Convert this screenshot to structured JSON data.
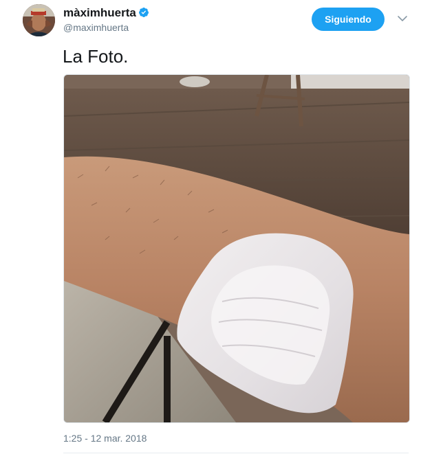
{
  "tweet": {
    "author": {
      "display_name": "màximhuerta",
      "handle": "@maximhuerta",
      "verified": true,
      "verified_icon": "verified-badge-icon",
      "avatar_icon": "avatar"
    },
    "follow_button_label": "Siguiendo",
    "menu_icon": "chevron-down-icon",
    "text": "La Foto.",
    "timestamp": "1:25 - 12 mar. 2018",
    "media": {
      "type": "photo"
    }
  },
  "colors": {
    "accent": "#1da1f2",
    "secondary_text": "#657786",
    "primary_text": "#14171a",
    "border": "#e1e8ed"
  }
}
